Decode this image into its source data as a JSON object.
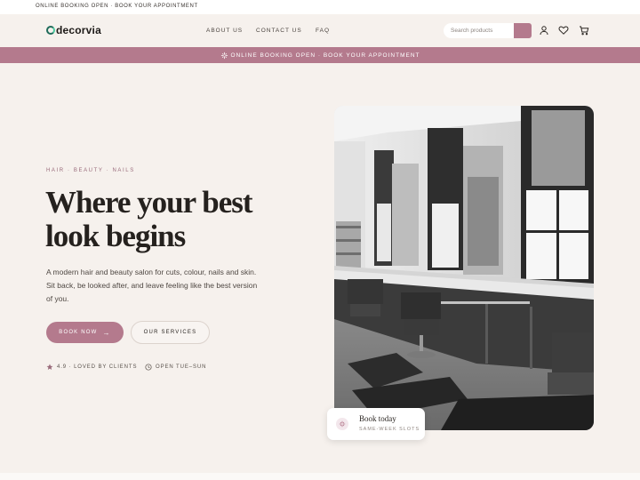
{
  "topbar": {
    "text": "ONLINE BOOKING OPEN · BOOK YOUR APPOINTMENT"
  },
  "header": {
    "logo": "decorvia",
    "nav": [
      {
        "label": "ABOUT US"
      },
      {
        "label": "CONTACT US"
      },
      {
        "label": "FAQ"
      }
    ],
    "search": {
      "placeholder": "Search products",
      "value": ""
    },
    "icons": [
      "user-icon",
      "heart-icon",
      "cart-icon",
      "search-icon"
    ]
  },
  "promo": {
    "text": "ONLINE BOOKING OPEN · BOOK YOUR APPOINTMENT",
    "icon": "sparkle-icon"
  },
  "hero": {
    "eyebrow": "HAIR · BEAUTY · NAILS",
    "headline_line1": "Where your best",
    "headline_line2": "look begins",
    "description": "A modern hair and beauty salon for cuts, colour, nails and skin. Sit back, be looked after, and leave feeling like the best version of you.",
    "primary_button": "BOOK NOW",
    "secondary_button": "OUR SERVICES",
    "rating_text": "4.9 · LOVED BY CLIENTS",
    "hours_text": "OPEN TUE–SUN"
  },
  "book_card": {
    "title": "Book today",
    "subtitle": "SAME-WEEK SLOTS"
  },
  "colors": {
    "accent": "#b47a8d",
    "background": "#f6f1ed",
    "text_dark": "#25211e",
    "topbar": "#ffffff"
  }
}
